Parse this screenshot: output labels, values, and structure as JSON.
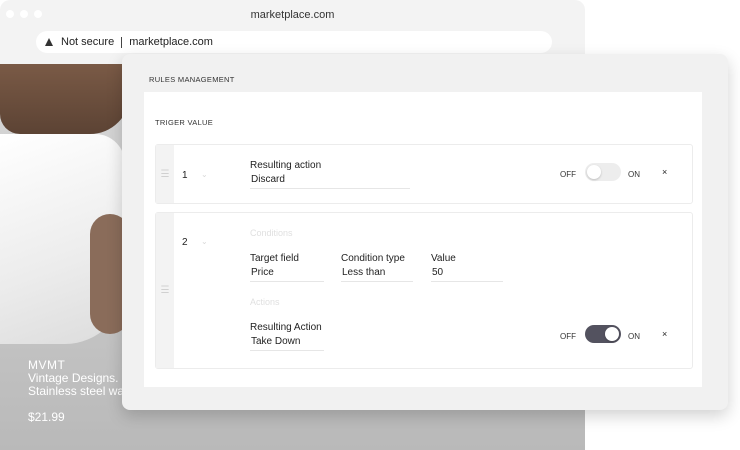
{
  "browser": {
    "window_title": "marketplace.com",
    "security_label": "Not secure",
    "url": "marketplace.com"
  },
  "product": {
    "brand": "MVMT",
    "description": "Vintage Designs.\nStainless steel wa",
    "price": "$21.99"
  },
  "rules": {
    "title": "RULES MANAGEMENT",
    "trigger_label": "TRIGER VALUE",
    "toggle_off_label": "OFF",
    "toggle_on_label": "ON",
    "close_symbol": "×",
    "items": [
      {
        "index": "1",
        "action_label": "Resulting action",
        "action_value": "Discard",
        "enabled": false
      },
      {
        "index": "2",
        "conditions_heading": "Conditions",
        "target_field_label": "Target field",
        "target_field_value": "Price",
        "condition_type_label": "Condition type",
        "condition_type_value": "Less than",
        "value_label": "Value",
        "value_value": "50",
        "actions_heading": "Actions",
        "action_label": "Resulting Action",
        "action_value": "Take Down",
        "enabled": true
      }
    ]
  },
  "icons": {
    "warning": "warning-triangle-icon",
    "drag": "drag-handle-icon",
    "chevron": "chevron-down-icon",
    "close": "close-icon"
  },
  "colors": {
    "toggle_on": "#53525f",
    "toggle_off": "#ededed",
    "modal_bg": "#f1f1f1"
  }
}
